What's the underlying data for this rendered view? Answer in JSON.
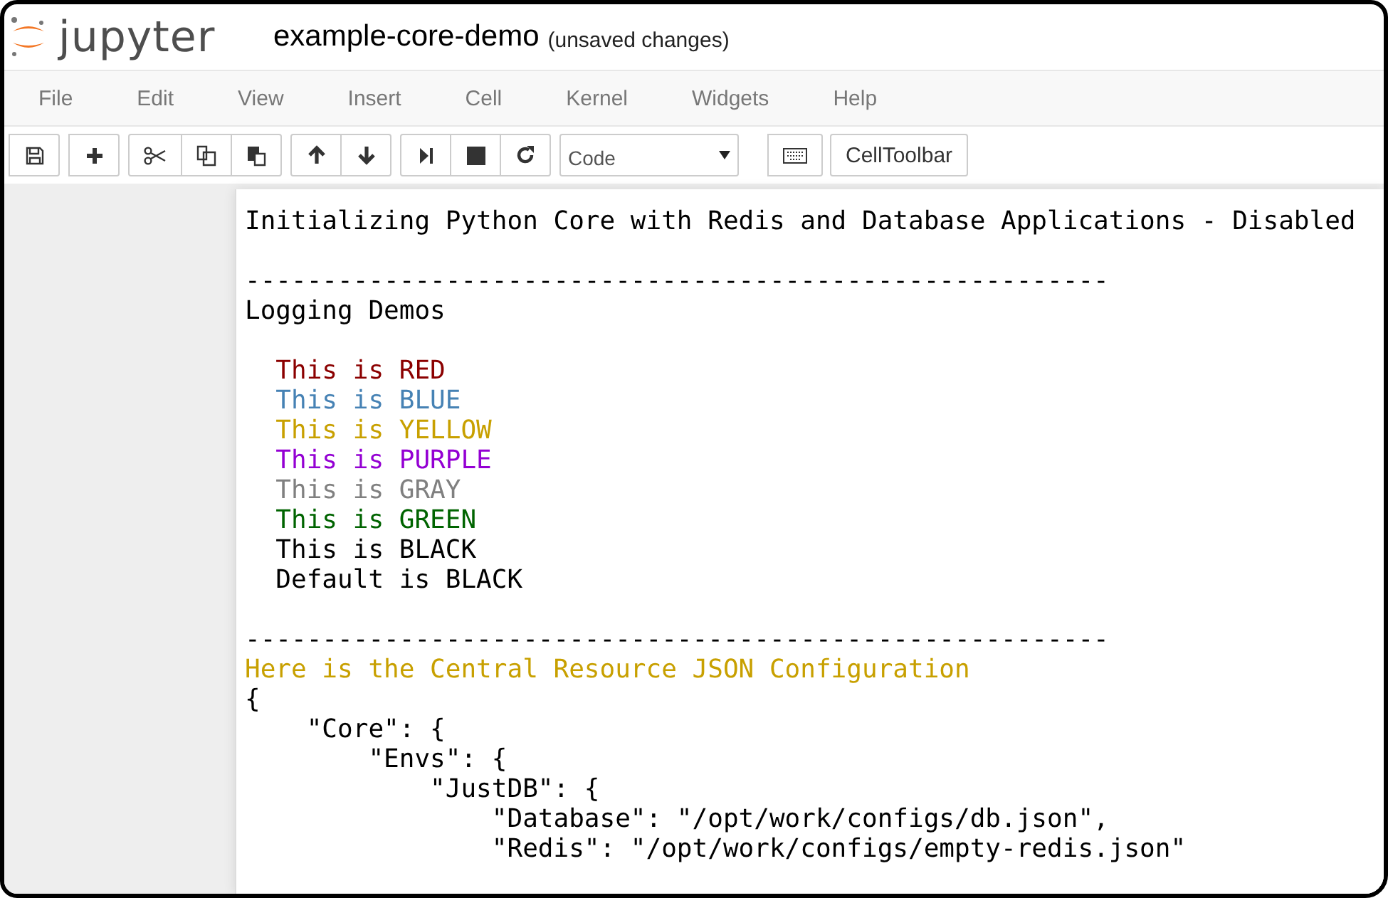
{
  "header": {
    "logo_text": "jupyter",
    "notebook_name": "example-core-demo",
    "save_status": "(unsaved changes)"
  },
  "menu": [
    "File",
    "Edit",
    "View",
    "Insert",
    "Cell",
    "Kernel",
    "Widgets",
    "Help"
  ],
  "toolbar": {
    "groups": [
      [
        {
          "kind": "save"
        }
      ],
      [
        {
          "kind": "add"
        }
      ],
      [
        {
          "kind": "cut"
        },
        {
          "kind": "copy"
        },
        {
          "kind": "paste"
        }
      ],
      [
        {
          "kind": "up"
        },
        {
          "kind": "down"
        }
      ],
      [
        {
          "kind": "run"
        },
        {
          "kind": "stop"
        },
        {
          "kind": "restart"
        }
      ]
    ],
    "cell_type": "Code",
    "cell_toolbar": "CellToolbar"
  },
  "output": {
    "lines": [
      {
        "text": "Initializing Python Core with Redis and Database Applications - Disabled",
        "color": "#000000"
      },
      {
        "text": "--------------------------------------------------------",
        "color": "#000000",
        "space_before": true
      },
      {
        "text": "Logging Demos",
        "color": "#000000"
      },
      {
        "text": "  This is RED",
        "color": "#8b0000",
        "space_before": true
      },
      {
        "text": "  This is BLUE",
        "color": "#4682b4"
      },
      {
        "text": "  This is YELLOW",
        "color": "#c8a000"
      },
      {
        "text": "  This is PURPLE",
        "color": "#9400d3"
      },
      {
        "text": "  This is GRAY",
        "color": "#808080"
      },
      {
        "text": "  This is GREEN",
        "color": "#006400"
      },
      {
        "text": "  This is BLACK",
        "color": "#000000"
      },
      {
        "text": "  Default is BLACK",
        "color": "#000000"
      },
      {
        "text": "--------------------------------------------------------",
        "color": "#000000",
        "space_before": true
      },
      {
        "text": "Here is the Central Resource JSON Configuration",
        "color": "#c8a000"
      },
      {
        "text": "{",
        "color": "#000000"
      },
      {
        "text": "    \"Core\": {",
        "color": "#000000"
      },
      {
        "text": "        \"Envs\": {",
        "color": "#000000"
      },
      {
        "text": "            \"JustDB\": {",
        "color": "#000000"
      },
      {
        "text": "                \"Database\": \"/opt/work/configs/db.json\",",
        "color": "#000000"
      },
      {
        "text": "                \"Redis\": \"/opt/work/configs/empty-redis.json\"",
        "color": "#000000"
      }
    ]
  }
}
